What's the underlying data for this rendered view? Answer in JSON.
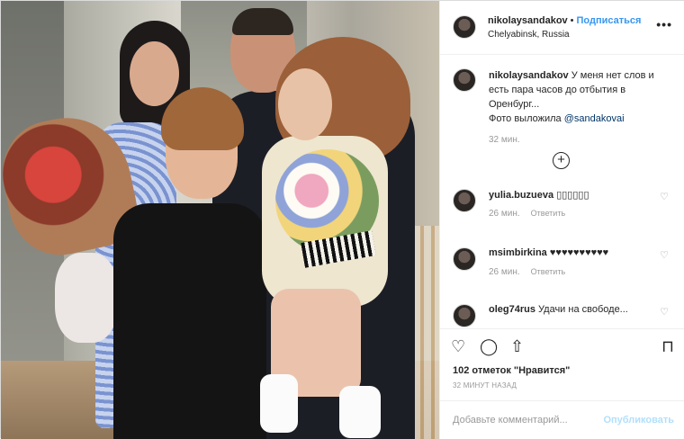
{
  "header": {
    "username": "nikolaysandakov",
    "separator": "•",
    "follow_label": "Подписаться",
    "location": "Chelyabinsk, Russia",
    "more_icon": "more-options-icon",
    "more_glyph": "•••"
  },
  "caption": {
    "username": "nikolaysandakov",
    "text": " У меня нет слов и есть пара часов до отбытия в Оренбург...",
    "photo_text": "Фото выложила ",
    "mention": "@sandakovai",
    "time": "32 мин."
  },
  "load_more": {
    "icon": "plus-circle-icon",
    "glyph": "+"
  },
  "comments": [
    {
      "username": "yulia.buzueva",
      "text": "▯▯▯▯▯▯",
      "time": "26 мин.",
      "reply": "Ответить"
    },
    {
      "username": "msimbirkina",
      "text": "♥♥♥♥♥♥♥♥♥♥",
      "time": "26 мин.",
      "reply": "Ответить"
    },
    {
      "username": "oleg74rus",
      "text": "Удачи на свободе...",
      "time": "",
      "reply": ""
    }
  ],
  "heart_glyph": "♡",
  "actions": {
    "like_icon": "heart-icon",
    "comment_icon": "comment-icon",
    "share_icon": "share-icon",
    "save_icon": "bookmark-icon",
    "like_glyph": "♡",
    "comment_glyph": "◯",
    "share_glyph": "⇧",
    "save_glyph": "⊓",
    "likes_text": "102 отметок \"Нравится\"",
    "ago": "32 МИНУТ НАЗАД"
  },
  "add_comment": {
    "placeholder": "Добавьте комментарий...",
    "publish_label": "Опубликовать"
  },
  "colors": {
    "link_blue": "#3897f0",
    "publish_disabled": "#b2dffc",
    "muted": "#999999"
  }
}
